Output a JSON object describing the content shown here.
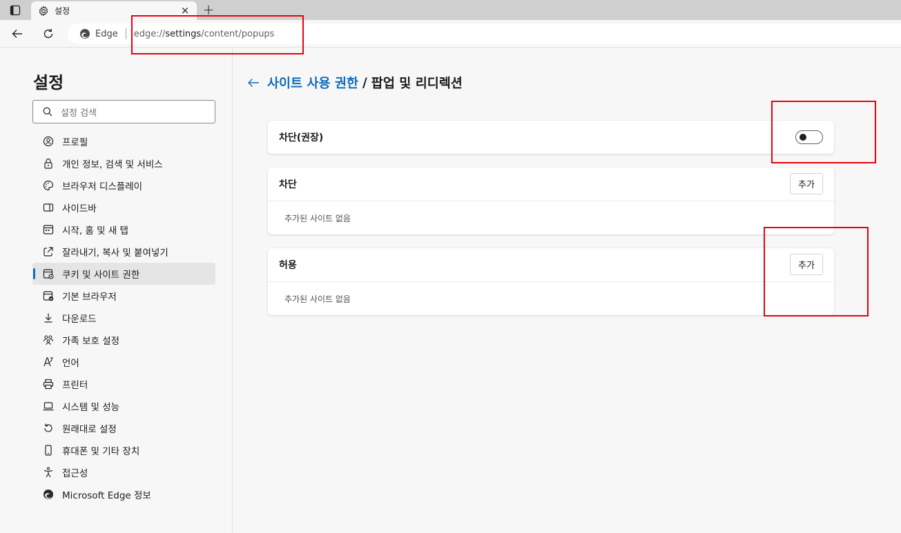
{
  "tab": {
    "title": "설정",
    "close_glyph": "×",
    "new_tab_glyph": "+"
  },
  "address": {
    "chip_label": "Edge",
    "url_prefix": "edge://",
    "url_host": "settings",
    "url_path": "/content/popups"
  },
  "sidebar": {
    "title": "설정",
    "search_placeholder": "설정 검색",
    "items": [
      {
        "label": "프로필",
        "icon": "profile-icon"
      },
      {
        "label": "개인 정보, 검색 및 서비스",
        "icon": "lock-icon"
      },
      {
        "label": "브라우저 디스플레이",
        "icon": "palette-icon"
      },
      {
        "label": "사이드바",
        "icon": "sidebar-icon"
      },
      {
        "label": "시작, 홈 및 새 탭",
        "icon": "home-tab-icon"
      },
      {
        "label": "잘라내기, 복사 및 붙여넣기",
        "icon": "share-icon"
      },
      {
        "label": "쿠키 및 사이트 권한",
        "icon": "cookie-permissions-icon",
        "active": true
      },
      {
        "label": "기본 브라우저",
        "icon": "default-browser-icon"
      },
      {
        "label": "다운로드",
        "icon": "download-icon"
      },
      {
        "label": "가족 보호 설정",
        "icon": "family-icon"
      },
      {
        "label": "언어",
        "icon": "language-icon"
      },
      {
        "label": "프린터",
        "icon": "printer-icon"
      },
      {
        "label": "시스템 및 성능",
        "icon": "laptop-icon"
      },
      {
        "label": "원래대로 설정",
        "icon": "reset-icon"
      },
      {
        "label": "휴대폰 및 기타 장치",
        "icon": "phone-icon"
      },
      {
        "label": "접근성",
        "icon": "accessibility-icon"
      },
      {
        "label": "Microsoft Edge 정보",
        "icon": "edge-logo-icon"
      }
    ]
  },
  "page": {
    "breadcrumb_parent": "사이트 사용 권한",
    "breadcrumb_separator": "/",
    "breadcrumb_current": "팝업 및 리디렉션",
    "block_recommended": {
      "label": "차단(권장)",
      "enabled": false
    },
    "block_section": {
      "title": "차단",
      "add_label": "추가",
      "empty_text": "추가된 사이트 없음"
    },
    "allow_section": {
      "title": "허용",
      "add_label": "추가",
      "empty_text": "추가된 사이트 없음"
    }
  },
  "colors": {
    "accent": "#0f6cbd",
    "highlight": "#e8000b"
  }
}
